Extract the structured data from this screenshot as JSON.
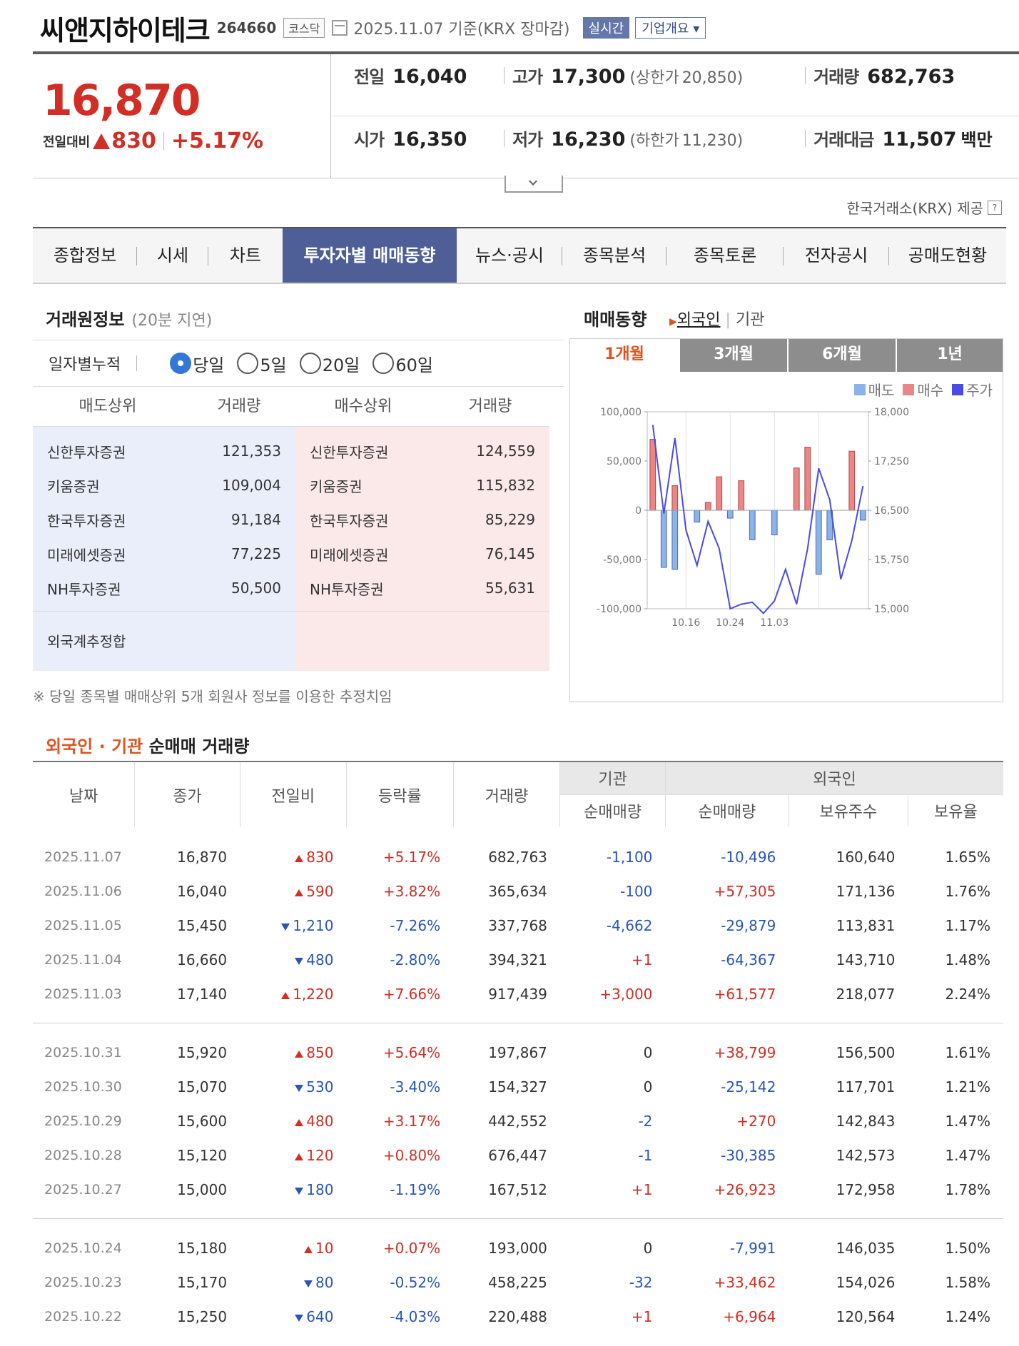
{
  "header": {
    "title": "씨앤지하이테크",
    "code": "264660",
    "market": "코스닥",
    "date_text": "2025.11.07 기준(KRX 장마감)",
    "live_label": "실시간",
    "corp_label": "기업개요"
  },
  "price": {
    "current": "16,870",
    "change_label": "전일대비",
    "change_amt": "830",
    "change_pct": "+5.17%",
    "prev_label": "전일",
    "prev": "16,040",
    "high_label": "고가",
    "high": "17,300",
    "upper_label": "(상한가",
    "upper": "20,850)",
    "vol_label": "거래량",
    "vol": "682,763",
    "open_label": "시가",
    "open": "16,350",
    "low_label": "저가",
    "low": "16,230",
    "lower_label": "(하한가",
    "lower": "11,230)",
    "amt_label": "거래대금",
    "amt": "11,507",
    "amt_unit": "백만",
    "source": "한국거래소(KRX) 제공"
  },
  "tabs": [
    "종합정보",
    "시세",
    "차트",
    "투자자별 매매동향",
    "뉴스·공시",
    "종목분석",
    "종목토론",
    "전자공시",
    "공매도현황"
  ],
  "broker": {
    "title": "거래원정보",
    "delay": "(20분 지연)",
    "period_label": "일자별누적",
    "periods": [
      "당일",
      "5일",
      "20일",
      "60일"
    ],
    "headers": [
      "매도상위",
      "거래량",
      "매수상위",
      "거래량"
    ],
    "sell": [
      {
        "name": "신한투자증권",
        "vol": "121,353"
      },
      {
        "name": "키움증권",
        "vol": "109,004"
      },
      {
        "name": "한국투자증권",
        "vol": "91,184"
      },
      {
        "name": "미래에셋증권",
        "vol": "77,225"
      },
      {
        "name": "NH투자증권",
        "vol": "50,500"
      }
    ],
    "buy": [
      {
        "name": "신한투자증권",
        "vol": "124,559"
      },
      {
        "name": "키움증권",
        "vol": "115,832"
      },
      {
        "name": "한국투자증권",
        "vol": "85,229"
      },
      {
        "name": "미래에셋증권",
        "vol": "76,145"
      },
      {
        "name": "NH투자증권",
        "vol": "55,631"
      }
    ],
    "foreign_total_label": "외국계추정합",
    "note": "※ 당일 종목별 매매상위 5개 회원사 정보를 이용한 추정치임"
  },
  "trend": {
    "title": "매매동향",
    "link_foreign": "외국인",
    "link_inst": "기관",
    "periods": [
      "1개월",
      "3개월",
      "6개월",
      "1년"
    ]
  },
  "chart_data": {
    "type": "bar",
    "legend": [
      "매도",
      "매수",
      "주가"
    ],
    "colors": {
      "sell": "#8cb2ea",
      "buy": "#ec8585",
      "price": "#4a4ae6"
    },
    "y_left": {
      "ticks": [
        "100,000",
        "50,000",
        "0",
        "-50,000",
        "-100,000"
      ],
      "range": [
        -100000,
        100000
      ]
    },
    "y_right": {
      "ticks": [
        "18,000",
        "17,250",
        "16,500",
        "15,750",
        "15,000"
      ],
      "range": [
        15000,
        18000
      ]
    },
    "x_ticks": [
      "10.16",
      "10.24",
      "11.03"
    ],
    "series": [
      {
        "name": "매수",
        "values": [
          72000,
          0,
          25000,
          0,
          0,
          8000,
          34000,
          0,
          30000,
          0,
          0,
          0,
          0,
          43000,
          64000,
          0,
          0,
          0,
          60000,
          0
        ]
      },
      {
        "name": "매도",
        "values": [
          0,
          -58000,
          -60000,
          0,
          -12000,
          0,
          0,
          -8000,
          0,
          -30000,
          0,
          -25000,
          0,
          0,
          0,
          -65000,
          -30000,
          0,
          0,
          -10000
        ]
      },
      {
        "name": "주가",
        "values": [
          17800,
          16450,
          17600,
          16200,
          15660,
          16330,
          15920,
          15000,
          15070,
          15100,
          14930,
          15120,
          15600,
          15070,
          15920,
          17140,
          16660,
          15450,
          16040,
          16870
        ]
      }
    ]
  },
  "table": {
    "title_hl": "외국인 · 기관",
    "title": "순매매 거래량",
    "headers": [
      "날짜",
      "종가",
      "전일비",
      "등락률",
      "거래량"
    ],
    "group_inst": "기관",
    "group_foreign": "외국인",
    "sub_inst": "순매매량",
    "sub_foreign": [
      "순매매량",
      "보유주수",
      "보유율"
    ],
    "rows": [
      [
        "2025.11.07",
        "16,870",
        "up",
        "830",
        "+5.17%",
        "682,763",
        "-1,100",
        "-10,496",
        "160,640",
        "1.65%"
      ],
      [
        "2025.11.06",
        "16,040",
        "up",
        "590",
        "+3.82%",
        "365,634",
        "-100",
        "+57,305",
        "171,136",
        "1.76%"
      ],
      [
        "2025.11.05",
        "15,450",
        "dn",
        "1,210",
        "-7.26%",
        "337,768",
        "-4,662",
        "-29,879",
        "113,831",
        "1.17%"
      ],
      [
        "2025.11.04",
        "16,660",
        "dn",
        "480",
        "-2.80%",
        "394,321",
        "+1",
        "-64,367",
        "143,710",
        "1.48%"
      ],
      [
        "2025.11.03",
        "17,140",
        "up",
        "1,220",
        "+7.66%",
        "917,439",
        "+3,000",
        "+61,577",
        "218,077",
        "2.24%"
      ],
      [
        "2025.10.31",
        "15,920",
        "up",
        "850",
        "+5.64%",
        "197,867",
        "0",
        "+38,799",
        "156,500",
        "1.61%"
      ],
      [
        "2025.10.30",
        "15,070",
        "dn",
        "530",
        "-3.40%",
        "154,327",
        "0",
        "-25,142",
        "117,701",
        "1.21%"
      ],
      [
        "2025.10.29",
        "15,600",
        "up",
        "480",
        "+3.17%",
        "442,552",
        "-2",
        "+270",
        "142,843",
        "1.47%"
      ],
      [
        "2025.10.28",
        "15,120",
        "up",
        "120",
        "+0.80%",
        "676,447",
        "-1",
        "-30,385",
        "142,573",
        "1.47%"
      ],
      [
        "2025.10.27",
        "15,000",
        "dn",
        "180",
        "-1.19%",
        "167,512",
        "+1",
        "+26,923",
        "172,958",
        "1.78%"
      ],
      [
        "2025.10.24",
        "15,180",
        "up",
        "10",
        "+0.07%",
        "193,000",
        "0",
        "-7,991",
        "146,035",
        "1.50%"
      ],
      [
        "2025.10.23",
        "15,170",
        "dn",
        "80",
        "-0.52%",
        "458,225",
        "-32",
        "+33,462",
        "154,026",
        "1.58%"
      ],
      [
        "2025.10.22",
        "15,250",
        "dn",
        "640",
        "-4.03%",
        "220,488",
        "+1",
        "+6,964",
        "120,564",
        "1.24%"
      ]
    ]
  }
}
